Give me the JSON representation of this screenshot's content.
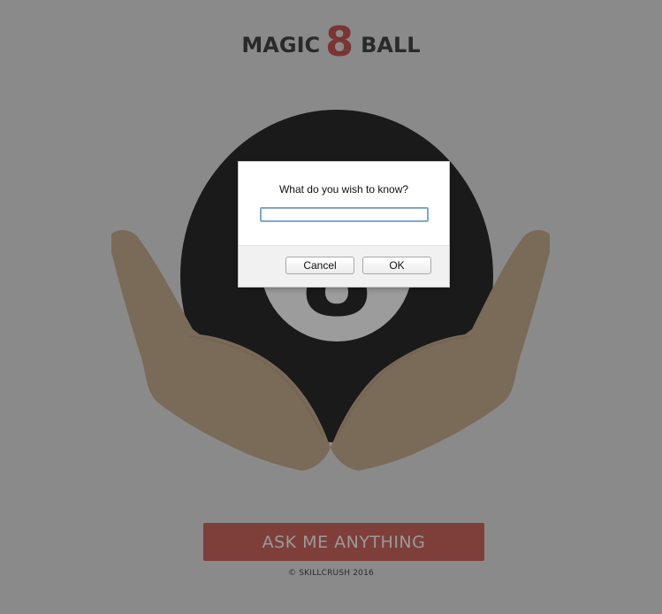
{
  "header": {
    "title_left": "MAGIC",
    "title_number": "8",
    "title_right": "BALL"
  },
  "ball": {
    "number": "8"
  },
  "dialog": {
    "prompt": "What do you wish to know?",
    "input_value": "",
    "cancel_label": "Cancel",
    "ok_label": "OK"
  },
  "main": {
    "ask_button_label": "ASK ME ANYTHING"
  },
  "footer": {
    "copyright": "© SKILLCRUSH 2016"
  },
  "colors": {
    "background": "#8a8a8a",
    "accent": "#7e3f3b",
    "ball": "#1a1a1a",
    "hands": "#7a6a58"
  }
}
